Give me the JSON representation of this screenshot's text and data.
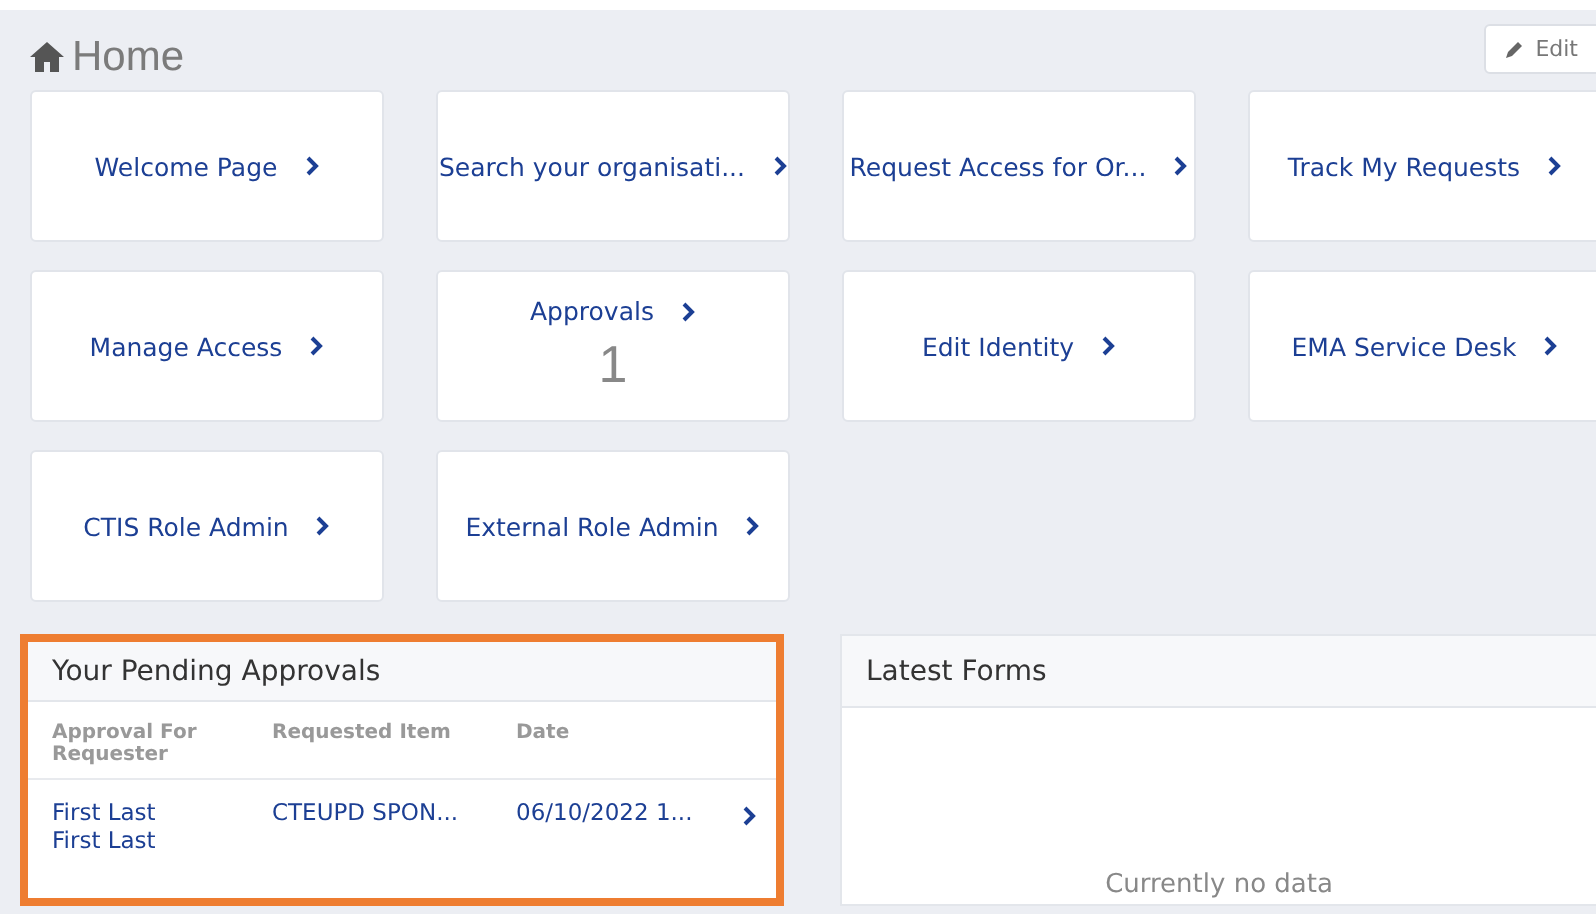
{
  "page": {
    "title": "Home",
    "edit_button": "Edit"
  },
  "tiles": [
    {
      "label": "Welcome Page"
    },
    {
      "label": "Search your organisati..."
    },
    {
      "label": "Request Access for Or..."
    },
    {
      "label": "Track My Requests"
    },
    {
      "label": "Manage Access"
    },
    {
      "label": "Approvals",
      "count": "1"
    },
    {
      "label": "Edit Identity"
    },
    {
      "label": "EMA Service Desk"
    },
    {
      "label": "CTIS Role Admin"
    },
    {
      "label": "External Role Admin"
    }
  ],
  "pending_approvals": {
    "title": "Your Pending Approvals",
    "columns": [
      "Approval For Requester",
      "Requested Item",
      "Date"
    ],
    "rows": [
      {
        "requester": [
          "First Last",
          "First Last"
        ],
        "item": "CTEUPD SPON...",
        "date": "06/10/2022 1..."
      }
    ]
  },
  "latest_forms": {
    "title": "Latest Forms",
    "empty_text": "Currently no data"
  }
}
